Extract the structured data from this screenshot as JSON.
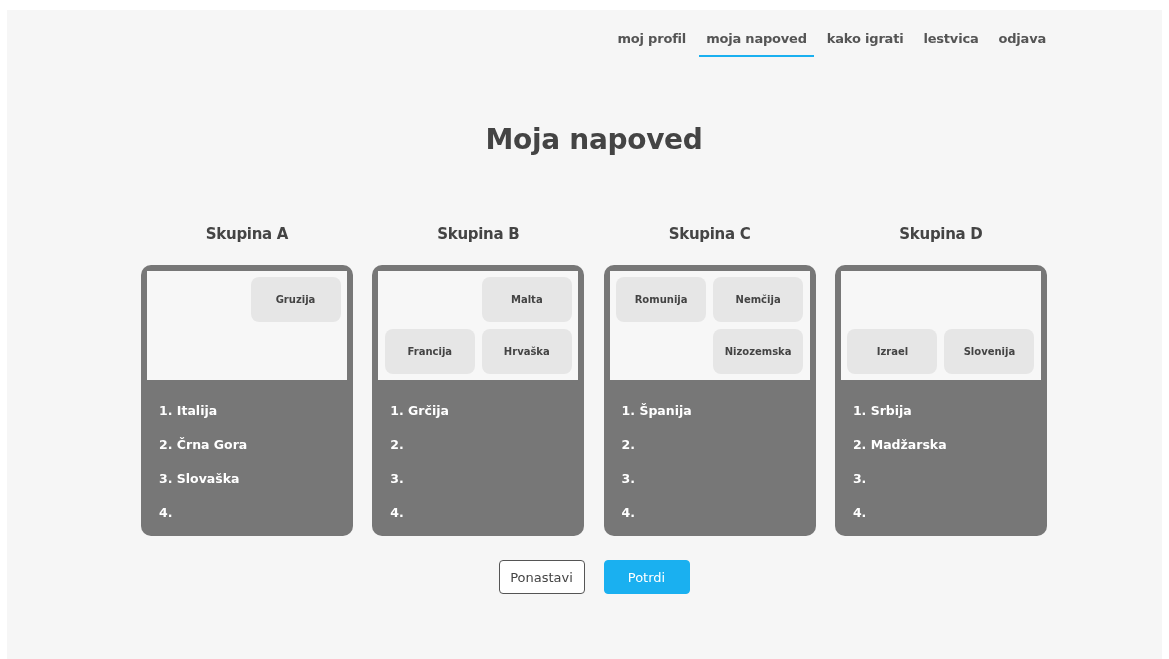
{
  "nav": [
    {
      "label": "moj profil",
      "selected": false
    },
    {
      "label": "moja napoved",
      "selected": true
    },
    {
      "label": "kako igrati",
      "selected": false
    },
    {
      "label": "lestvica",
      "selected": false
    },
    {
      "label": "odjava",
      "selected": false
    }
  ],
  "title": "Moja napoved",
  "groups": [
    {
      "name": "Skupina A",
      "pool": [
        {
          "kind": "empty"
        },
        {
          "kind": "team",
          "team": "Gruzija"
        },
        {
          "kind": "empty"
        },
        {
          "kind": "empty"
        }
      ],
      "ranking": [
        "1. Italija",
        "2. Črna Gora",
        "3. Slovaška",
        "4."
      ]
    },
    {
      "name": "Skupina B",
      "pool": [
        {
          "kind": "empty"
        },
        {
          "kind": "team",
          "team": "Malta"
        },
        {
          "kind": "team",
          "team": "Francija"
        },
        {
          "kind": "team",
          "team": "Hrvaška"
        }
      ],
      "ranking": [
        "1. Grčija",
        "2.",
        "3.",
        "4."
      ]
    },
    {
      "name": "Skupina C",
      "pool": [
        {
          "kind": "team",
          "team": "Romunija"
        },
        {
          "kind": "team",
          "team": "Nemčija"
        },
        {
          "kind": "empty"
        },
        {
          "kind": "team",
          "team": "Nizozemska"
        }
      ],
      "ranking": [
        "1. Španija",
        "2.",
        "3.",
        "4."
      ]
    },
    {
      "name": "Skupina D",
      "pool": [
        {
          "kind": "empty"
        },
        {
          "kind": "empty"
        },
        {
          "kind": "team",
          "team": "Izrael"
        },
        {
          "kind": "team",
          "team": "Slovenija"
        }
      ],
      "ranking": [
        "1. Srbija",
        "2. Madžarska",
        "3.",
        "4."
      ]
    }
  ],
  "buttons": [
    {
      "label": "Ponastavi",
      "kind": "outline"
    },
    {
      "label": "Potrdi",
      "kind": "primary"
    }
  ]
}
